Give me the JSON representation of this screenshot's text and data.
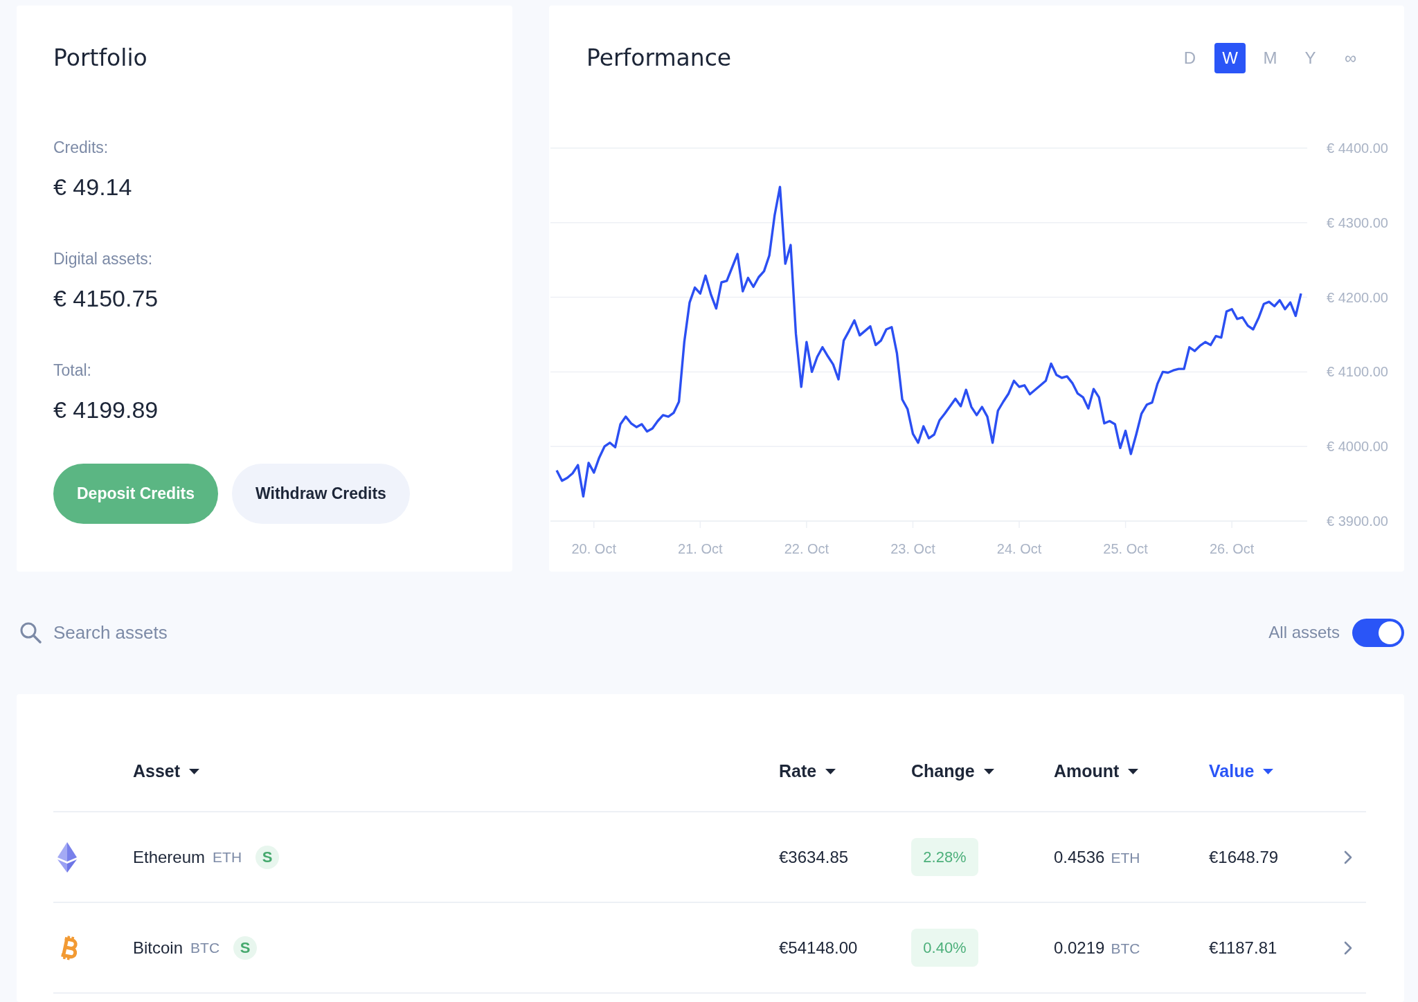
{
  "portfolio": {
    "title": "Portfolio",
    "stats": [
      {
        "label": "Credits:",
        "value": "€ 49.14"
      },
      {
        "label": "Digital assets:",
        "value": "€ 4150.75"
      },
      {
        "label": "Total:",
        "value": "€ 4199.89"
      }
    ],
    "buttons": [
      {
        "label": "Deposit Credits",
        "kind": "primary"
      },
      {
        "label": "Withdraw Credits",
        "kind": "secondary"
      }
    ]
  },
  "performance": {
    "title": "Performance",
    "periods": [
      {
        "label": "D",
        "selected": false
      },
      {
        "label": "W",
        "selected": true
      },
      {
        "label": "M",
        "selected": false
      },
      {
        "label": "Y",
        "selected": false
      },
      {
        "label": "∞",
        "selected": false
      }
    ],
    "chart_data": {
      "type": "line",
      "grid": true,
      "categories": [
        null,
        null,
        null,
        null,
        null,
        null,
        null,
        "20. Oct",
        null,
        null,
        null,
        null,
        null,
        null,
        null,
        null,
        null,
        null,
        null,
        null,
        null,
        null,
        null,
        null,
        null,
        null,
        null,
        "21. Oct",
        null,
        null,
        null,
        null,
        null,
        null,
        null,
        null,
        null,
        null,
        null,
        null,
        null,
        null,
        null,
        null,
        null,
        null,
        null,
        "22. Oct",
        null,
        null,
        null,
        null,
        null,
        null,
        null,
        null,
        null,
        null,
        null,
        null,
        null,
        null,
        null,
        null,
        null,
        null,
        null,
        "23. Oct",
        null,
        null,
        null,
        null,
        null,
        null,
        null,
        null,
        null,
        null,
        null,
        null,
        null,
        null,
        null,
        null,
        null,
        null,
        null,
        "24. Oct",
        null,
        null,
        null,
        null,
        null,
        null,
        null,
        null,
        null,
        null,
        null,
        null,
        null,
        null,
        null,
        null,
        null,
        null,
        null,
        "25. Oct",
        null,
        null,
        null,
        null,
        null,
        null,
        null,
        null,
        null,
        null,
        null,
        null,
        null,
        null,
        null,
        null,
        null,
        null,
        null,
        "26. Oct",
        null,
        null,
        null,
        null,
        null,
        null,
        null,
        null,
        null,
        null,
        null,
        null,
        null
      ],
      "series": [
        {
          "color": "#2b4ff2",
          "values": [
            3968,
            3954,
            3958,
            3964,
            3975,
            3933,
            3978,
            3965,
            3985,
            4000,
            4005,
            3999,
            4030,
            4040,
            4031,
            4026,
            4030,
            4020,
            4024,
            4034,
            4042,
            4040,
            4045,
            4060,
            4140,
            4193,
            4213,
            4205,
            4229,
            4204,
            4185,
            4220,
            4222,
            4240,
            4258,
            4208,
            4226,
            4214,
            4227,
            4235,
            4256,
            4310,
            4348,
            4245,
            4270,
            4151,
            4080,
            4140,
            4100,
            4120,
            4133,
            4121,
            4110,
            4090,
            4142,
            4155,
            4169,
            4149,
            4155,
            4161,
            4136,
            4142,
            4157,
            4160,
            4125,
            4063,
            4050,
            4017,
            4005,
            4027,
            4011,
            4016,
            4035,
            4044,
            4054,
            4064,
            4054,
            4076,
            4053,
            4042,
            4053,
            4040,
            4005,
            4048,
            4060,
            4071,
            4088,
            4080,
            4082,
            4070,
            4076,
            4082,
            4088,
            4111,
            4096,
            4092,
            4094,
            4085,
            4071,
            4066,
            4051,
            4077,
            4066,
            4031,
            4034,
            4030,
            3998,
            4021,
            3990,
            4016,
            4044,
            4056,
            4059,
            4084,
            4100,
            4099,
            4102,
            4104,
            4104,
            4133,
            4128,
            4135,
            4140,
            4136,
            4148,
            4146,
            4181,
            4184,
            4171,
            4173,
            4162,
            4157,
            4172,
            4191,
            4194,
            4188,
            4196,
            4184,
            4193,
            4175,
            4205
          ]
        }
      ],
      "ylim": [
        3900,
        4400
      ],
      "yticks": [
        {
          "value": 3900,
          "label": "€ 3900.00"
        },
        {
          "value": 4000,
          "label": "€ 4000.00"
        },
        {
          "value": 4100,
          "label": "€ 4100.00"
        },
        {
          "value": 4200,
          "label": "€ 4200.00"
        },
        {
          "value": 4300,
          "label": "€ 4300.00"
        },
        {
          "value": 4400,
          "label": "€ 4400.00"
        }
      ]
    }
  },
  "search": {
    "placeholder": "Search assets"
  },
  "filter_toggle": {
    "label": "All assets",
    "on": true
  },
  "table": {
    "columns": [
      {
        "label": "Asset",
        "selected": false
      },
      {
        "label": "Rate",
        "selected": false
      },
      {
        "label": "Change",
        "selected": false
      },
      {
        "label": "Amount",
        "selected": false
      },
      {
        "label": "Value",
        "selected": true
      }
    ],
    "rows": [
      {
        "kind": "ethereum",
        "asset": "Ethereum",
        "ticker": "ETH",
        "badge": "S",
        "rate": "€3634.85",
        "change": "2.28%",
        "amount": "0.4536",
        "amount_unit": "ETH",
        "value": "€1648.79"
      },
      {
        "kind": "bitcoin",
        "asset": "Bitcoin",
        "ticker": "BTC",
        "badge": "S",
        "rate": "€54148.00",
        "change": "0.40%",
        "amount": "0.0219",
        "amount_unit": "BTC",
        "value": "€1187.81"
      }
    ]
  }
}
